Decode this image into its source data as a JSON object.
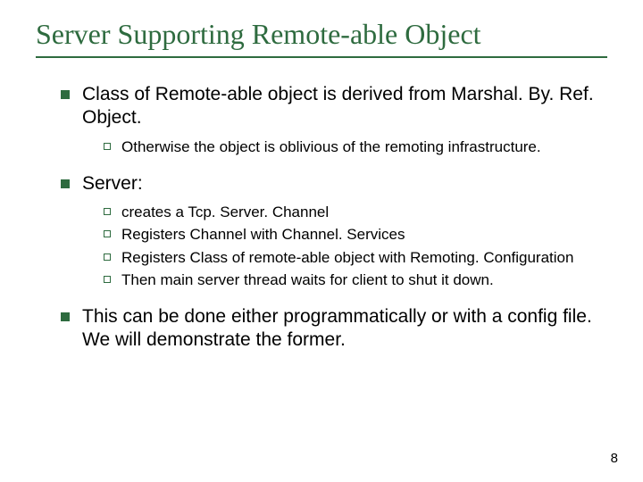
{
  "title": "Server Supporting Remote-able Object",
  "bullets": {
    "b1": "Class of Remote-able object is derived from Marshal. By. Ref. Object.",
    "b1_sub": {
      "s1": "Otherwise the object is oblivious of the remoting infrastructure."
    },
    "b2": "Server:",
    "b2_sub": {
      "s1": "creates a Tcp. Server. Channel",
      "s2": "Registers Channel with Channel. Services",
      "s3": "Registers Class of remote-able object with Remoting. Configuration",
      "s4": "Then main server thread waits for client to shut it down."
    },
    "b3": "This can be done either programmatically or with a config file.  We will demonstrate the former."
  },
  "page_number": "8"
}
